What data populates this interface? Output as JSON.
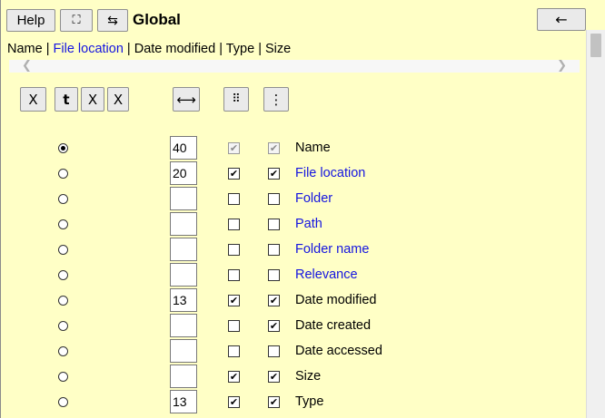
{
  "toolbar": {
    "help_label": "Help",
    "fullscreen_icon": "⛶",
    "swap_icon": "⇆",
    "title": "Global",
    "back_icon": "←"
  },
  "breadcrumb": {
    "items": [
      {
        "label": "Name",
        "link": false
      },
      {
        "label": "File location",
        "link": true
      },
      {
        "label": "Date modified",
        "link": false
      },
      {
        "label": "Type",
        "link": false
      },
      {
        "label": "Size",
        "link": false
      }
    ],
    "separator": " | "
  },
  "scroll": {
    "left_arrow": "❮",
    "right_arrow": "❯"
  },
  "tools": {
    "x1": "X",
    "t": "t",
    "x2": "X",
    "x3": "X",
    "width_icon": "⟷",
    "grid_icon": "⠿",
    "vdots_icon": "⋮"
  },
  "rows": [
    {
      "name": "Name",
      "width": "40",
      "selected": true,
      "cb1": true,
      "cb2": true,
      "dim": true,
      "link": false
    },
    {
      "name": "File location",
      "width": "20",
      "selected": false,
      "cb1": true,
      "cb2": true,
      "dim": false,
      "link": true
    },
    {
      "name": "Folder",
      "width": "",
      "selected": false,
      "cb1": false,
      "cb2": false,
      "dim": false,
      "link": true
    },
    {
      "name": "Path",
      "width": "",
      "selected": false,
      "cb1": false,
      "cb2": false,
      "dim": false,
      "link": true
    },
    {
      "name": "Folder name",
      "width": "",
      "selected": false,
      "cb1": false,
      "cb2": false,
      "dim": false,
      "link": true
    },
    {
      "name": "Relevance",
      "width": "",
      "selected": false,
      "cb1": false,
      "cb2": false,
      "dim": false,
      "link": true
    },
    {
      "name": "Date modified",
      "width": "13",
      "selected": false,
      "cb1": true,
      "cb2": true,
      "dim": false,
      "link": false
    },
    {
      "name": "Date created",
      "width": "",
      "selected": false,
      "cb1": false,
      "cb2": true,
      "dim": false,
      "link": false
    },
    {
      "name": "Date accessed",
      "width": "",
      "selected": false,
      "cb1": false,
      "cb2": false,
      "dim": false,
      "link": false
    },
    {
      "name": "Size",
      "width": "",
      "selected": false,
      "cb1": true,
      "cb2": true,
      "dim": false,
      "link": false
    },
    {
      "name": "Type",
      "width": "13",
      "selected": false,
      "cb1": true,
      "cb2": true,
      "dim": false,
      "link": false
    }
  ],
  "check_glyph": "✔",
  "colors": {
    "background": "#ffffc6",
    "link": "#1515e0"
  }
}
